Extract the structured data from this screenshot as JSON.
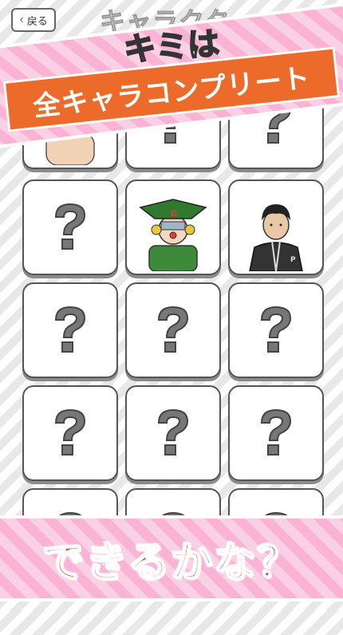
{
  "header": {
    "back_label": "戻る",
    "title": "キャラクター"
  },
  "banner": {
    "line1": "キミは",
    "line2": "全キャラコンプリート",
    "bottom": "できるかな？"
  },
  "colors": {
    "banner_pink": "#f7b8d6",
    "orange_box": "#ec6a2a",
    "bottom_text": "#e8452a"
  },
  "cards": [
    {
      "state": "unlocked",
      "icon": "bald-man-icon"
    },
    {
      "state": "locked",
      "icon": "question-mark-icon"
    },
    {
      "state": "locked",
      "icon": "question-mark-icon"
    },
    {
      "state": "locked",
      "icon": "question-mark-icon"
    },
    {
      "state": "unlocked",
      "icon": "green-hat-masked-man-icon"
    },
    {
      "state": "unlocked",
      "icon": "tracksuit-man-icon"
    },
    {
      "state": "locked",
      "icon": "question-mark-icon"
    },
    {
      "state": "locked",
      "icon": "question-mark-icon"
    },
    {
      "state": "locked",
      "icon": "question-mark-icon"
    },
    {
      "state": "locked",
      "icon": "question-mark-icon"
    },
    {
      "state": "locked",
      "icon": "question-mark-icon"
    },
    {
      "state": "locked",
      "icon": "question-mark-icon"
    },
    {
      "state": "locked",
      "icon": "question-mark-icon"
    },
    {
      "state": "locked",
      "icon": "question-mark-icon"
    },
    {
      "state": "locked",
      "icon": "question-mark-icon"
    }
  ]
}
